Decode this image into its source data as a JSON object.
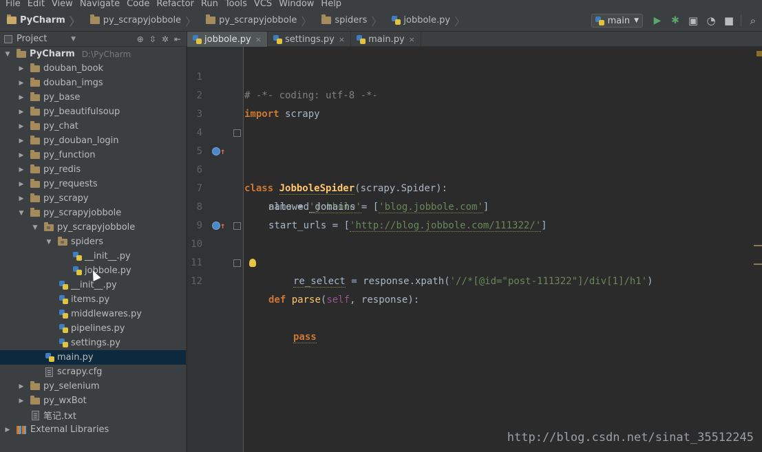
{
  "menu": [
    "File",
    "Edit",
    "View",
    "Navigate",
    "Code",
    "Refactor",
    "Run",
    "Tools",
    "VCS",
    "Window",
    "Help"
  ],
  "breadcrumb": [
    "PyCharm",
    "py_scrapyjobbole",
    "py_scrapyjobbole",
    "spiders",
    "jobbole.py"
  ],
  "run_config": "main",
  "project_panel": {
    "selector_label": "Project"
  },
  "tree": [
    {
      "label": "PyCharm",
      "path": "D:\\PyCharm"
    },
    {
      "label": "douban_book"
    },
    {
      "label": "douban_imgs"
    },
    {
      "label": "py_base"
    },
    {
      "label": "py_beautifulsoup"
    },
    {
      "label": "py_chat"
    },
    {
      "label": "py_douban_login"
    },
    {
      "label": "py_function"
    },
    {
      "label": "py_redis"
    },
    {
      "label": "py_requests"
    },
    {
      "label": "py_scrapy"
    },
    {
      "label": "py_scrapyjobbole"
    },
    {
      "label": "py_scrapyjobbole"
    },
    {
      "label": "spiders"
    },
    {
      "label": "__init__.py"
    },
    {
      "label": "jobbole.py"
    },
    {
      "label": "__init__.py"
    },
    {
      "label": "items.py"
    },
    {
      "label": "middlewares.py"
    },
    {
      "label": "pipelines.py"
    },
    {
      "label": "settings.py"
    },
    {
      "label": "main.py"
    },
    {
      "label": "scrapy.cfg"
    },
    {
      "label": "py_selenium"
    },
    {
      "label": "py_wxBot"
    },
    {
      "label": "笔记.txt"
    },
    {
      "label": "External Libraries"
    }
  ],
  "tabs": [
    {
      "label": "jobbole.py",
      "active": true
    },
    {
      "label": "settings.py",
      "active": false
    },
    {
      "label": "main.py",
      "active": false
    }
  ],
  "editor": {
    "line_numbers": [
      "1",
      "2",
      "3",
      "4",
      "5",
      "6",
      "7",
      "8",
      "9",
      "10",
      "11",
      "12"
    ],
    "l1": "# -*- coding: utf-8 -*-",
    "l2_kw": "import",
    "l2_rest": " scrapy",
    "l5_kw": "class",
    "l5_name": "JobboleSpider",
    "l5_rest": "(scrapy.Spider):",
    "l6_a": "name = ",
    "l6_s": "'jobbole'",
    "l7_a": "allowed_domains = [",
    "l7_s": "'blog.jobbole.com'",
    "l7_b": "]",
    "l8_a": "start_urls = [",
    "l8_s": "'http://blog.jobbole.com/111322/'",
    "l8_b": "]",
    "l10_kw": "def",
    "l10_fn": "parse",
    "l10_p1": "(",
    "l10_self": "self",
    "l10_p2": ", response):",
    "l11_var": "re_select",
    "l11_a": " = response.xpath(",
    "l11_s": "'//*[@id=\"post-111322\"]/div[1]/h1'",
    "l11_b": ")",
    "l12_kw": "pass"
  },
  "watermark": "http://blog.csdn.net/sinat_35512245"
}
